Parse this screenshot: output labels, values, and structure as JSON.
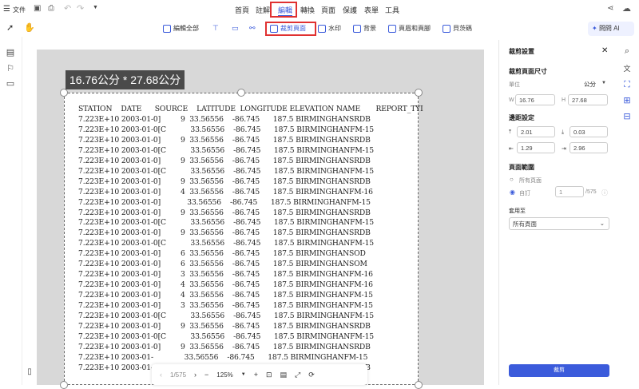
{
  "app": {
    "file_menu": "文件",
    "menus": [
      "首頁",
      "註解",
      "編輯",
      "轉換",
      "頁面",
      "保護",
      "表單",
      "工具"
    ],
    "active_menu": "編輯",
    "ai_button": "問問 AI"
  },
  "edit_tools": {
    "edit_all": "編輯全部",
    "crop_page": "裁剪頁面",
    "watermark": "水印",
    "background": "背景",
    "header_footer": "頁眉和頁腳",
    "bates": "貝茨碼"
  },
  "canvas": {
    "dimension_label": "16.76公分 * 27.68公分",
    "doc_header": "STATION    DATE      SOURCE    LATITUDE  LONGITUDE ELEVATION NAME       REPORT_TYI",
    "doc_rows": [
      "7.223E+10 2003-01-0]         9  33.56556    -86.745      187.5 BIRMINGHANSRDB",
      "7.223E+10 2003-01-0[C           33.56556    -86.745      187.5 BIRMINGHANFM-15",
      "7.223E+10 2003-01-0]         9  33.56556    -86.745      187.5 BIRMINGHANSRDB",
      "7.223E+10 2003-01-0[C           33.56556    -86.745      187.5 BIRMINGHANFM-15",
      "7.223E+10 2003-01-0]         9  33.56556    -86.745      187.5 BIRMINGHANSRDB",
      "7.223E+10 2003-01-0[C           33.56556    -86.745      187.5 BIRMINGHANFM-15",
      "7.223E+10 2003-01-0]         9  33.56556    -86.745      187.5 BIRMINGHANSRDB",
      "7.223E+10 2003-01-0]         4  33.56556    -86.745      187.5 BIRMINGHANFM-16",
      "7.223E+10 2003-01-0]            33.56556    -86.745      187.5 BIRMINGHANFM-15",
      "7.223E+10 2003-01-0]         9  33.56556    -86.745      187.5 BIRMINGHANSRDB",
      "7.223E+10 2003-01-0[C           33.56556    -86.745      187.5 BIRMINGHANFM-15",
      "7.223E+10 2003-01-0]         9  33.56556    -86.745      187.5 BIRMINGHANSRDB",
      "7.223E+10 2003-01-0[C           33.56556    -86.745      187.5 BIRMINGHANFM-15",
      "7.223E+10 2003-01-0]         6  33.56556    -86.745      187.5 BIRMINGHANSOD",
      "7.223E+10 2003-01-0]         6  33.56556    -86.745      187.5 BIRMINGHANSOM",
      "7.223E+10 2003-01-0]         3  33.56556    -86.745      187.5 BIRMINGHANFM-16",
      "7.223E+10 2003-01-0]         4  33.56556    -86.745      187.5 BIRMINGHANFM-16",
      "7.223E+10 2003-01-0]         4  33.56556    -86.745      187.5 BIRMINGHANFM-15",
      "7.223E+10 2003-01-0]         3  33.56556    -86.745      187.5 BIRMINGHANFM-15",
      "7.223E+10 2003-01-0[C           33.56556    -86.745      187.5 BIRMINGHANFM-15",
      "7.223E+10 2003-01-0]         9  33.56556    -86.745      187.5 BIRMINGHANSRDB",
      "7.223E+10 2003-01-0[C           33.56556    -86.745      187.5 BIRMINGHANFM-15",
      "7.223E+10 2003-01-0]         9  33.56556    -86.745      187.5 BIRMINGHANSRDB",
      "7.223E+10 2003-01-              33.56556    -86.745      187.5 BIRMINGHANFM-15",
      "7.223E+10 2003-01-0]         9  33.56556    -86.745      187.5 BIRMINGHANSRDB"
    ]
  },
  "bottom_bar": {
    "page_indicator": "1/575",
    "zoom": "125%"
  },
  "crop_panel": {
    "title": "裁剪設置",
    "size_section": "裁剪頁面尺寸",
    "unit_label": "單位",
    "unit_value": "公分",
    "w_label": "W",
    "w_value": "16.76",
    "h_label": "H",
    "h_value": "27.68",
    "margin_section": "邊距設定",
    "margin_top": "2.01",
    "margin_bottom": "0.03",
    "margin_left": "1.29",
    "margin_right": "2.96",
    "range_section": "頁面範圍",
    "all_pages": "所有頁面",
    "custom": "自訂",
    "custom_from": "1",
    "custom_total": "/575",
    "apply_to_label": "套用至",
    "apply_to_value": "所有頁面",
    "apply_button": "裁剪"
  },
  "colors": {
    "accent": "#3b5bdb",
    "highlight_border": "#e03131",
    "canvas_bg": "#d8d8d8",
    "dim_label_bg": "#4a4a4a"
  }
}
